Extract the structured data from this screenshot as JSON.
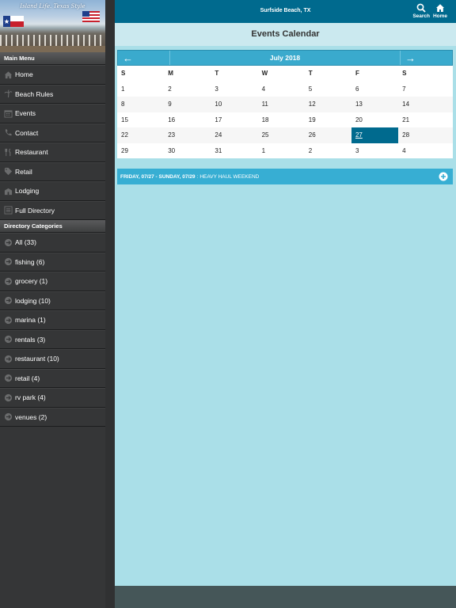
{
  "banner": {
    "tagline": "Island Life. Texas Style"
  },
  "sidebar": {
    "main_menu_header": "Main Menu",
    "main_menu": [
      {
        "label": "Home",
        "icon": "home-icon"
      },
      {
        "label": "Beach Rules",
        "icon": "palm-tree-icon"
      },
      {
        "label": "Events",
        "icon": "calendar-icon"
      },
      {
        "label": "Contact",
        "icon": "phone-icon"
      },
      {
        "label": "Restaurant",
        "icon": "fork-knife-icon"
      },
      {
        "label": "Retail",
        "icon": "tag-icon"
      },
      {
        "label": "Lodging",
        "icon": "building-icon"
      },
      {
        "label": "Full Directory",
        "icon": "list-icon"
      }
    ],
    "categories_header": "Directory Categories",
    "categories": [
      {
        "label": "All (33)"
      },
      {
        "label": "fishing (6)"
      },
      {
        "label": "grocery (1)"
      },
      {
        "label": "lodging (10)"
      },
      {
        "label": "marina (1)"
      },
      {
        "label": "rentals (3)"
      },
      {
        "label": "restaurant (10)"
      },
      {
        "label": "retail (4)"
      },
      {
        "label": "rv park (4)"
      },
      {
        "label": "venues (2)"
      }
    ]
  },
  "topbar": {
    "location": "Surfside Beach, TX",
    "search_label": "Search",
    "home_label": "Home"
  },
  "page": {
    "title": "Events Calendar"
  },
  "calendar": {
    "prev_arrow": "←",
    "next_arrow": "→",
    "month_label": "July 2018",
    "weekday_headers": [
      "S",
      "M",
      "T",
      "W",
      "T",
      "F",
      "S"
    ],
    "weeks": [
      [
        "1",
        "2",
        "3",
        "4",
        "5",
        "6",
        "7"
      ],
      [
        "8",
        "9",
        "10",
        "11",
        "12",
        "13",
        "14"
      ],
      [
        "15",
        "16",
        "17",
        "18",
        "19",
        "20",
        "21"
      ],
      [
        "22",
        "23",
        "24",
        "25",
        "26",
        "27",
        "28"
      ],
      [
        "29",
        "30",
        "31",
        "1",
        "2",
        "3",
        "4"
      ]
    ],
    "selected_day": "27"
  },
  "event": {
    "date_range": "FRIDAY, 07/27 - SUNDAY, 07/29",
    "separator": ":",
    "title": "HEAVY HAUL WEEKEND"
  },
  "colors": {
    "topbar": "#006a8e",
    "accent": "#3aaacd",
    "selected_day": "#006a8e",
    "main_bg": "#aadfe8",
    "sidebar_bg": "#353637",
    "footer": "#455658"
  }
}
